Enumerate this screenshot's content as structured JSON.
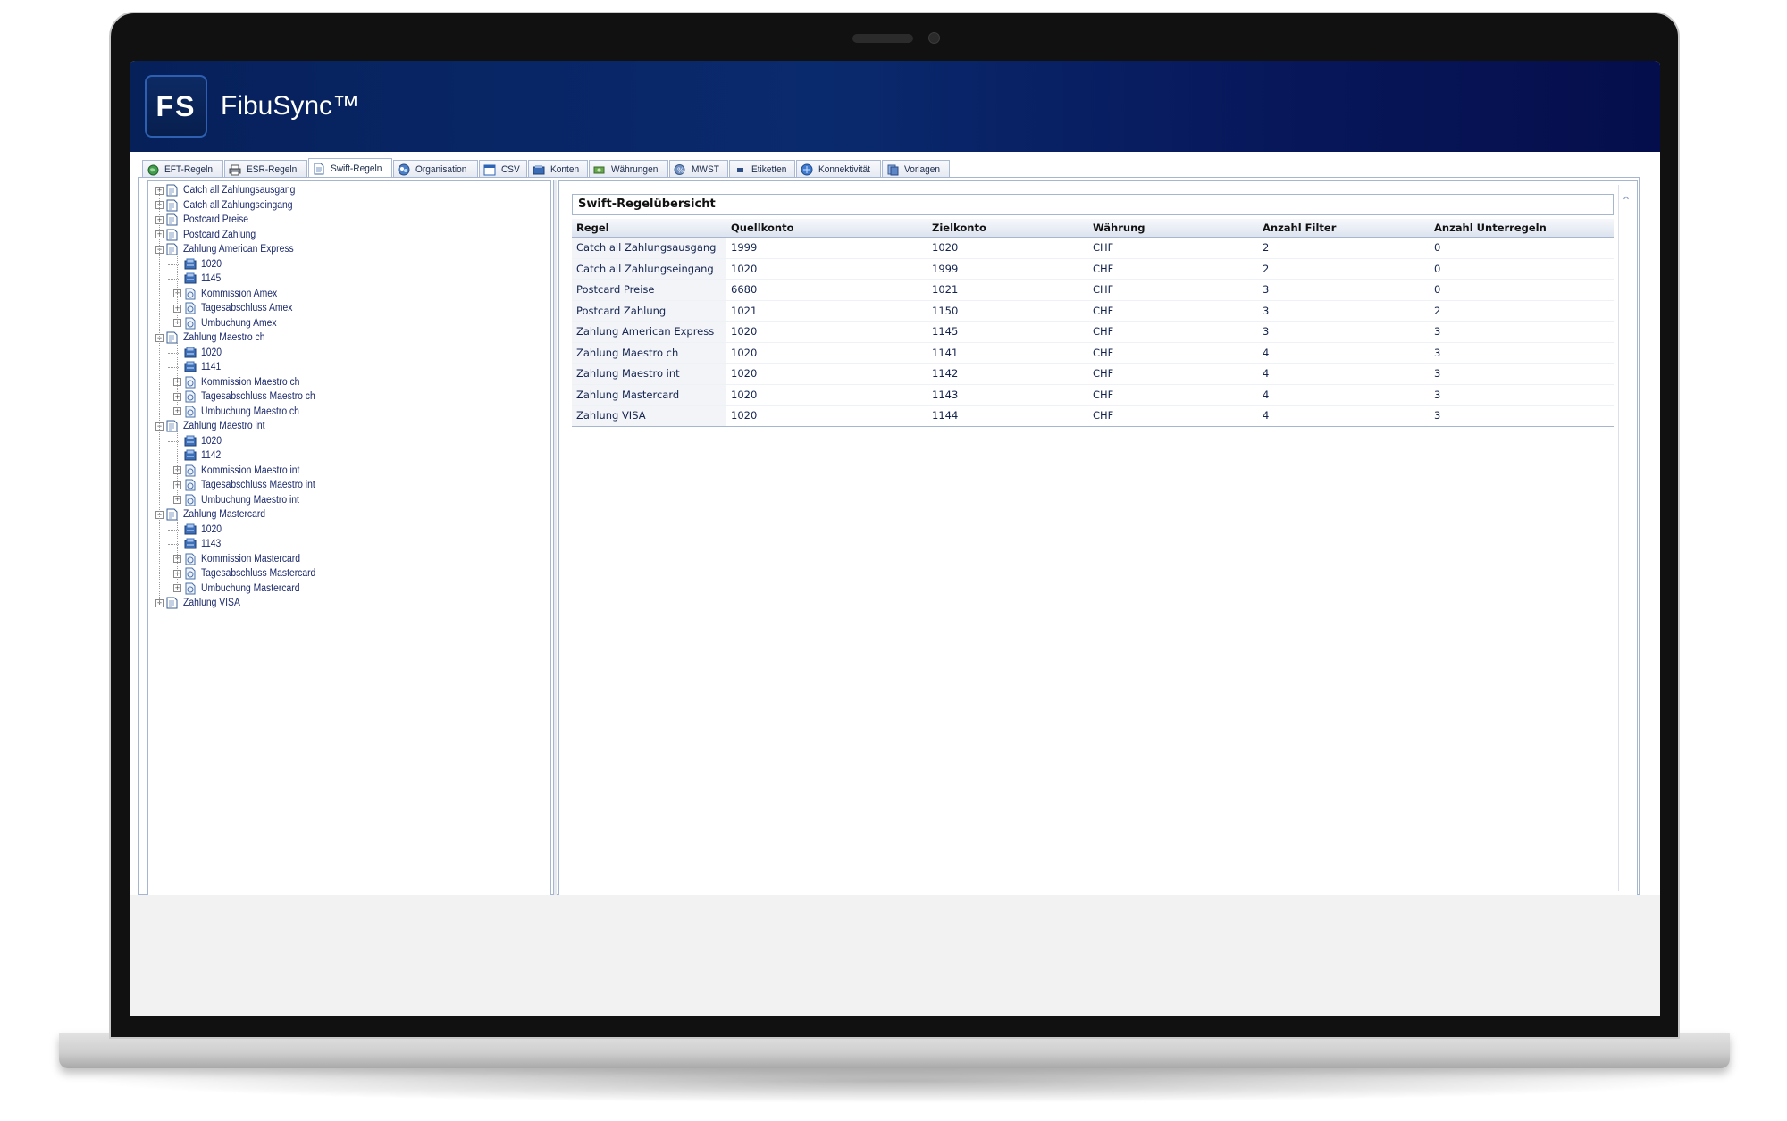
{
  "app": {
    "logo_text": "FS",
    "title": "FibuSync™"
  },
  "tabs": [
    {
      "label": "EFT-Regeln",
      "icon": "globe-icon"
    },
    {
      "label": "ESR-Regeln",
      "icon": "printer-icon"
    },
    {
      "label": "Swift-Regeln",
      "icon": "document-icon",
      "active": true
    },
    {
      "label": "Organisation",
      "icon": "organisation-icon"
    },
    {
      "label": "CSV",
      "icon": "window-icon"
    },
    {
      "label": "Konten",
      "icon": "accounts-icon"
    },
    {
      "label": "Währungen",
      "icon": "currency-icon"
    },
    {
      "label": "MWST",
      "icon": "tax-icon"
    },
    {
      "label": "Etiketten",
      "icon": "label-icon"
    },
    {
      "label": "Konnektivität",
      "icon": "connectivity-icon"
    },
    {
      "label": "Vorlagen",
      "icon": "templates-icon"
    }
  ],
  "tree": [
    {
      "label": "Catch all Zahlungsausgang",
      "level": 0,
      "type": "rule",
      "expander": "+"
    },
    {
      "label": "Catch all Zahlungseingang",
      "level": 0,
      "type": "rule",
      "expander": "+"
    },
    {
      "label": "Postcard Preise",
      "level": 0,
      "type": "rule",
      "expander": "+"
    },
    {
      "label": "Postcard Zahlung",
      "level": 0,
      "type": "rule",
      "expander": "+"
    },
    {
      "label": "Zahlung American Express",
      "level": 0,
      "type": "rule",
      "expander": "-"
    },
    {
      "label": "1020",
      "level": 1,
      "type": "account",
      "expander": ""
    },
    {
      "label": "1145",
      "level": 1,
      "type": "account",
      "expander": ""
    },
    {
      "label": "Kommission Amex",
      "level": 1,
      "type": "subrule",
      "expander": "+"
    },
    {
      "label": "Tagesabschluss Amex",
      "level": 1,
      "type": "subrule",
      "expander": "+"
    },
    {
      "label": "Umbuchung Amex",
      "level": 1,
      "type": "subrule",
      "expander": "+"
    },
    {
      "label": "Zahlung Maestro ch",
      "level": 0,
      "type": "rule",
      "expander": "-"
    },
    {
      "label": "1020",
      "level": 1,
      "type": "account",
      "expander": ""
    },
    {
      "label": "1141",
      "level": 1,
      "type": "account",
      "expander": ""
    },
    {
      "label": "Kommission Maestro ch",
      "level": 1,
      "type": "subrule",
      "expander": "+"
    },
    {
      "label": "Tagesabschluss Maestro ch",
      "level": 1,
      "type": "subrule",
      "expander": "+"
    },
    {
      "label": "Umbuchung Maestro ch",
      "level": 1,
      "type": "subrule",
      "expander": "+"
    },
    {
      "label": "Zahlung Maestro int",
      "level": 0,
      "type": "rule",
      "expander": "-"
    },
    {
      "label": "1020",
      "level": 1,
      "type": "account",
      "expander": ""
    },
    {
      "label": "1142",
      "level": 1,
      "type": "account",
      "expander": ""
    },
    {
      "label": "Kommission Maestro int",
      "level": 1,
      "type": "subrule",
      "expander": "+"
    },
    {
      "label": "Tagesabschluss Maestro int",
      "level": 1,
      "type": "subrule",
      "expander": "+"
    },
    {
      "label": "Umbuchung Maestro int",
      "level": 1,
      "type": "subrule",
      "expander": "+"
    },
    {
      "label": "Zahlung Mastercard",
      "level": 0,
      "type": "rule",
      "expander": "-"
    },
    {
      "label": "1020",
      "level": 1,
      "type": "account",
      "expander": ""
    },
    {
      "label": "1143",
      "level": 1,
      "type": "account",
      "expander": ""
    },
    {
      "label": "Kommission Mastercard",
      "level": 1,
      "type": "subrule",
      "expander": "+"
    },
    {
      "label": "Tagesabschluss Mastercard",
      "level": 1,
      "type": "subrule",
      "expander": "+"
    },
    {
      "label": "Umbuchung Mastercard",
      "level": 1,
      "type": "subrule",
      "expander": "+"
    },
    {
      "label": "Zahlung VISA",
      "level": 0,
      "type": "rule",
      "expander": "+"
    }
  ],
  "overview": {
    "title": "Swift-Regelübersicht",
    "columns": [
      "Regel",
      "Quellkonto",
      "Zielkonto",
      "Währung",
      "Anzahl Filter",
      "Anzahl Unterregeln"
    ],
    "rows": [
      [
        "Catch all Zahlungsausgang",
        "1999",
        "1020",
        "CHF",
        "2",
        "0"
      ],
      [
        "Catch all Zahlungseingang",
        "1020",
        "1999",
        "CHF",
        "2",
        "0"
      ],
      [
        "Postcard Preise",
        "6680",
        "1021",
        "CHF",
        "3",
        "0"
      ],
      [
        "Postcard Zahlung",
        "1021",
        "1150",
        "CHF",
        "3",
        "2"
      ],
      [
        "Zahlung American Express",
        "1020",
        "1145",
        "CHF",
        "3",
        "3"
      ],
      [
        "Zahlung Maestro ch",
        "1020",
        "1141",
        "CHF",
        "4",
        "3"
      ],
      [
        "Zahlung Maestro int",
        "1020",
        "1142",
        "CHF",
        "4",
        "3"
      ],
      [
        "Zahlung Mastercard",
        "1020",
        "1143",
        "CHF",
        "4",
        "3"
      ],
      [
        "Zahlung VISA",
        "1020",
        "1144",
        "CHF",
        "4",
        "3"
      ]
    ]
  },
  "colors": {
    "header_start": "#06205a",
    "header_end": "#050e4c",
    "tree_text": "#1c2a6b",
    "border": "#a6b6cf"
  }
}
